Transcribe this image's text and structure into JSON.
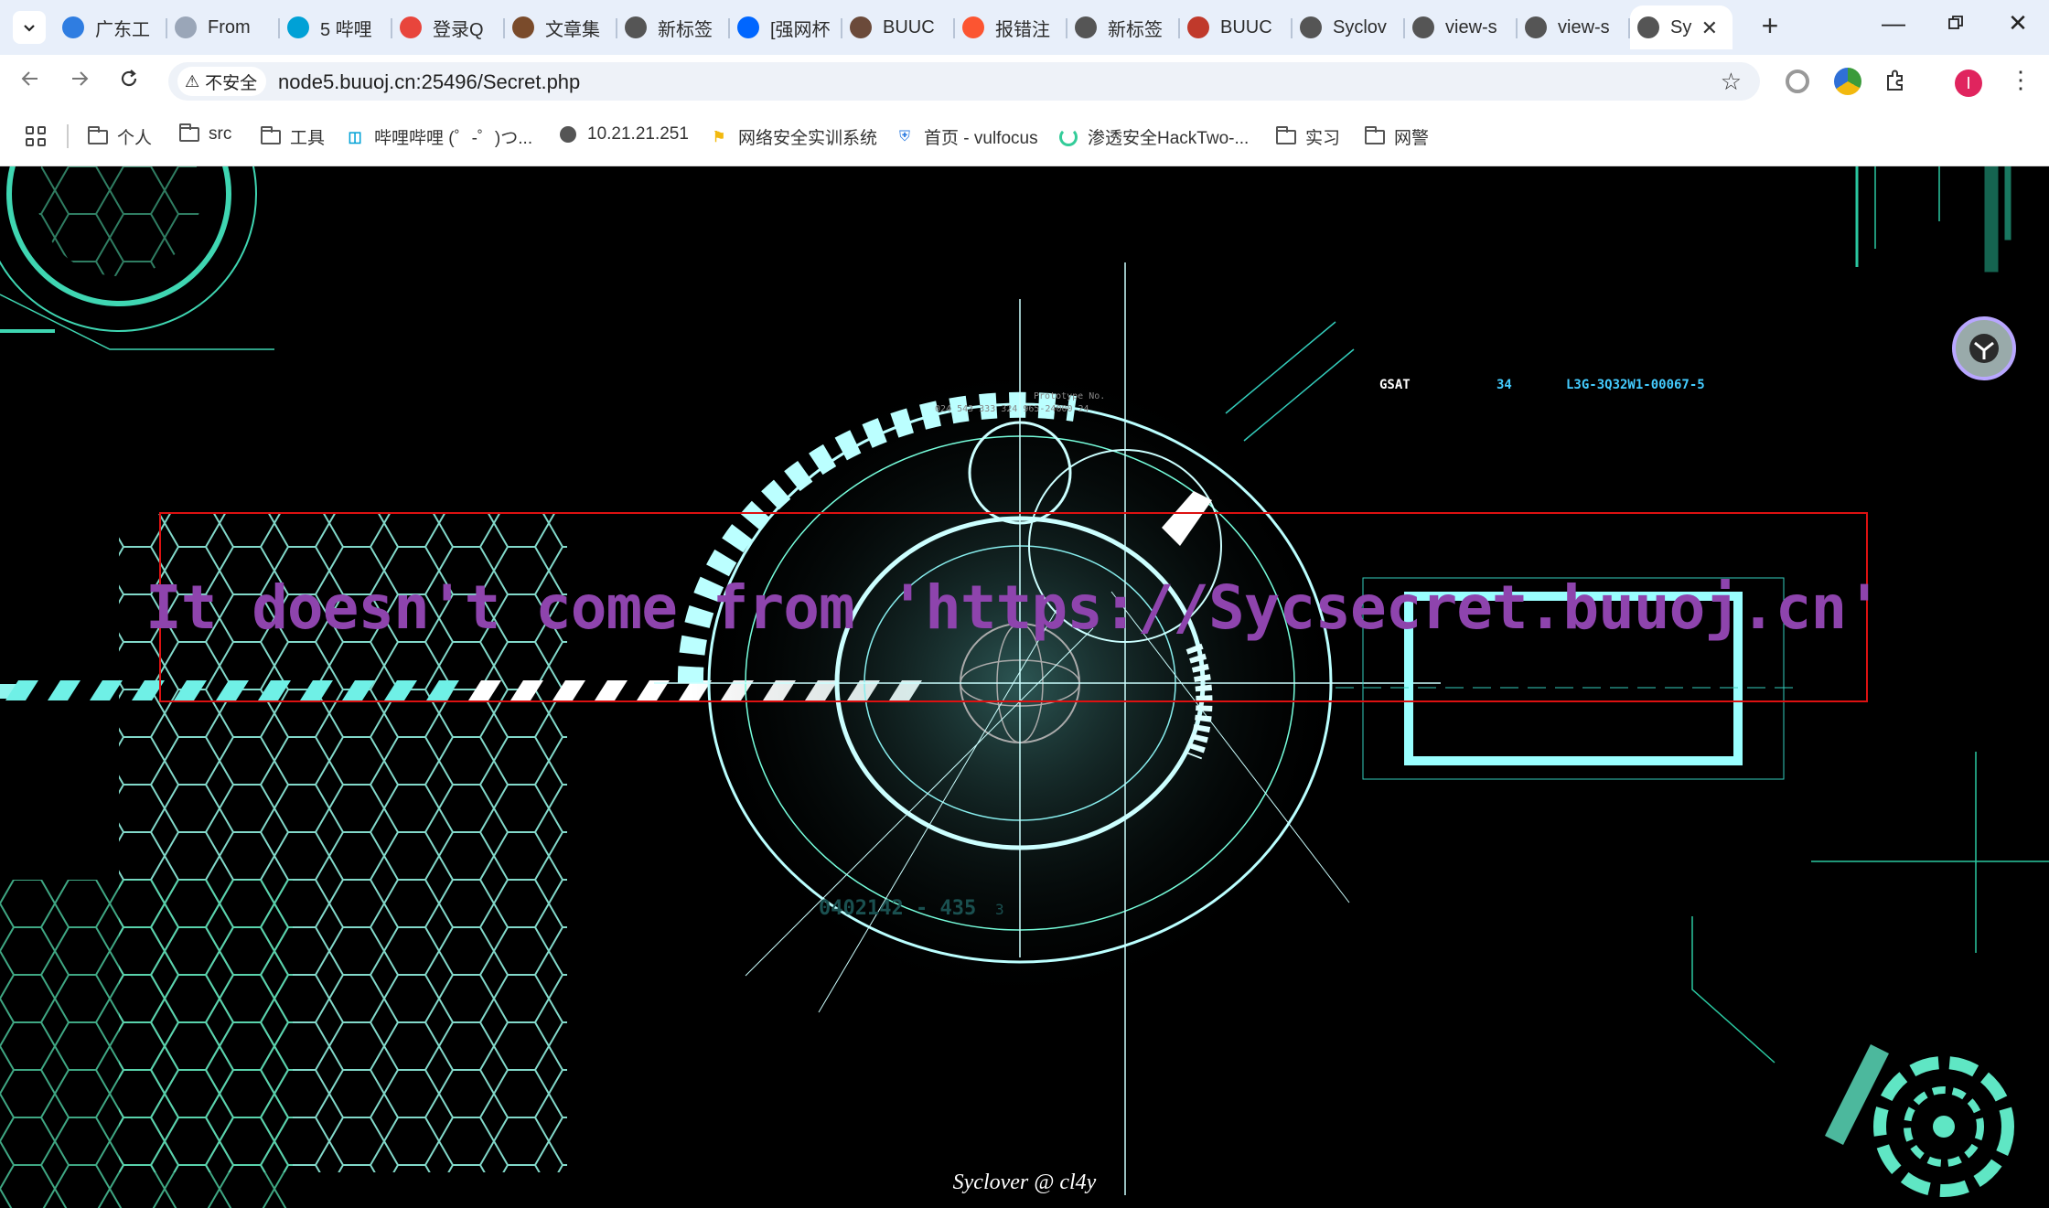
{
  "tabs": [
    {
      "title": "广东工",
      "icon": "globe-blue-icon",
      "color": "#2f7de1"
    },
    {
      "title": "From",
      "icon": "shield-icon",
      "color": "#9aa6b8"
    },
    {
      "title": "5 哔哩",
      "icon": "bilibili-icon",
      "color": "#00a1d6"
    },
    {
      "title": "登录Q",
      "icon": "chrome-icon",
      "color": "#e8453c"
    },
    {
      "title": "文章集",
      "icon": "article-icon",
      "color": "#7a4b2b"
    },
    {
      "title": "新标签",
      "icon": "chrome-gray-icon",
      "color": "#555555"
    },
    {
      "title": "[强网杯",
      "icon": "zhihu-icon",
      "color": "#0066ff"
    },
    {
      "title": "BUUC",
      "icon": "buu-icon",
      "color": "#6b4a3a"
    },
    {
      "title": "报错注",
      "icon": "csdn-icon",
      "color": "#fc5531"
    },
    {
      "title": "新标签",
      "icon": "chrome-gray-icon",
      "color": "#555555"
    },
    {
      "title": "BUUC",
      "icon": "buu-red-icon",
      "color": "#c0392b"
    },
    {
      "title": "Syclov",
      "icon": "globe-icon",
      "color": "#555555"
    },
    {
      "title": "view-s",
      "icon": "globe-icon",
      "color": "#555555"
    },
    {
      "title": "view-s",
      "icon": "globe-icon",
      "color": "#555555"
    }
  ],
  "active_tab": {
    "title": "Sy",
    "icon": "globe-icon",
    "close_icon": "close-icon"
  },
  "omnibox": {
    "security_label": "不安全",
    "url": "node5.buuoj.cn:25496/Secret.php"
  },
  "bookmarks": [
    {
      "label": "个人",
      "icon": "folder-icon"
    },
    {
      "label": "src",
      "icon": "folder-icon"
    },
    {
      "label": "工具",
      "icon": "folder-icon"
    },
    {
      "label": "哔哩哔哩 (゜-゜)つ...",
      "icon": "bilibili-icon"
    },
    {
      "label": "10.21.21.251",
      "icon": "globe-icon"
    },
    {
      "label": "网络安全实训系统",
      "icon": "training-icon"
    },
    {
      "label": "首页 - vulfocus",
      "icon": "vulfocus-icon"
    },
    {
      "label": "渗透安全HackTwo-...",
      "icon": "loading-icon"
    },
    {
      "label": "实习",
      "icon": "folder-icon"
    },
    {
      "label": "网警",
      "icon": "folder-icon"
    }
  ],
  "page": {
    "message": "It doesn't come from 'https://Sycsecret.buuoj.cn'",
    "footer": "Syclover @ cl4y",
    "hud_label_left": "GSAT",
    "hud_label_mid": "34",
    "hud_label_right": "L3G-3Q32W1-00067-5",
    "hud_small": "Prototype No.",
    "hud_code": "024 543 333 324 965-24000 24",
    "hud_bottom": "0402142 - 435",
    "hud_bottom_suffix": "3"
  },
  "profile_initial": "I",
  "colors": {
    "accent_cyan": "#7ff6f0",
    "message_purple": "#8e44ad",
    "box_red": "#dd1111"
  }
}
